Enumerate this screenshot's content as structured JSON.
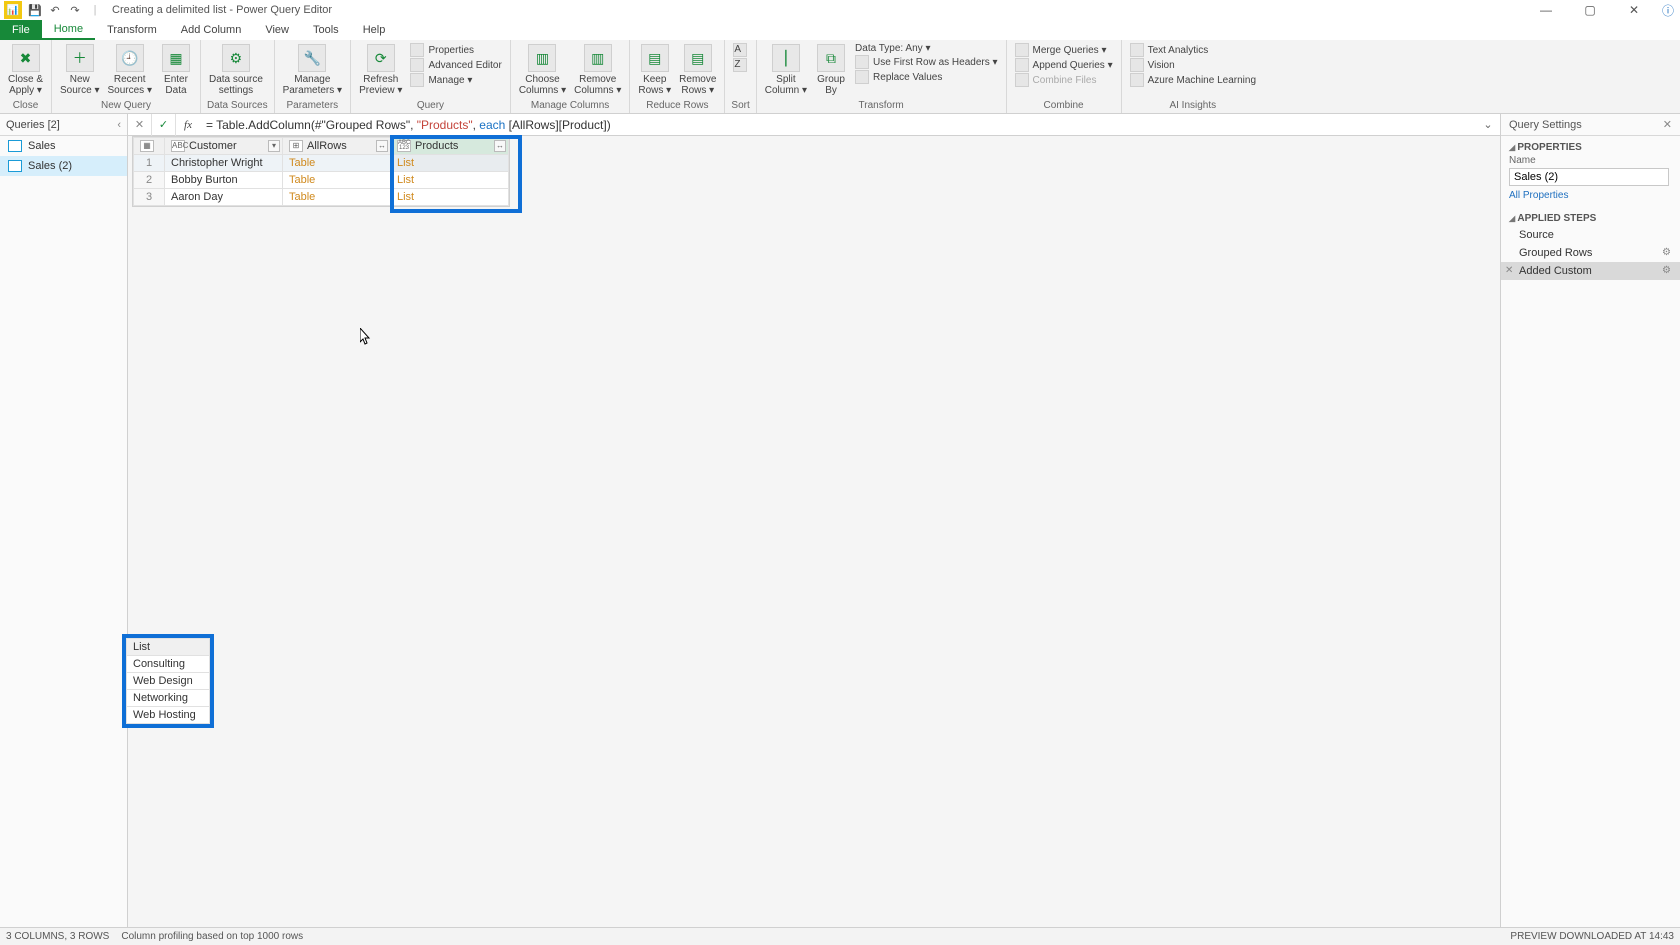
{
  "window": {
    "title": "Creating a delimited list - Power Query Editor"
  },
  "menu": {
    "file": "File",
    "home": "Home",
    "transform": "Transform",
    "addcolumn": "Add Column",
    "view": "View",
    "tools": "Tools",
    "help": "Help"
  },
  "ribbon": {
    "close_apply": "Close &\nApply ▾",
    "new_source": "New\nSource ▾",
    "recent_sources": "Recent\nSources ▾",
    "enter_data": "Enter\nData",
    "data_source_settings": "Data source\nsettings",
    "manage_parameters": "Manage\nParameters ▾",
    "refresh_preview": "Refresh\nPreview ▾",
    "properties": "Properties",
    "advanced_editor": "Advanced Editor",
    "manage": "Manage ▾",
    "choose_columns": "Choose\nColumns ▾",
    "remove_columns": "Remove\nColumns ▾",
    "keep_rows": "Keep\nRows ▾",
    "remove_rows": "Remove\nRows ▾",
    "sort": "",
    "split_column": "Split\nColumn ▾",
    "group_by": "Group\nBy",
    "data_type": "Data Type: Any ▾",
    "first_row_headers": "Use First Row as Headers ▾",
    "replace_values": "Replace Values",
    "merge_queries": "Merge Queries ▾",
    "append_queries": "Append Queries ▾",
    "combine_files": "Combine Files",
    "text_analytics": "Text Analytics",
    "vision": "Vision",
    "azure_ml": "Azure Machine Learning",
    "groups": {
      "close": "Close",
      "new_query": "New Query",
      "data_sources": "Data Sources",
      "parameters": "Parameters",
      "query": "Query",
      "manage_columns": "Manage Columns",
      "reduce_rows": "Reduce Rows",
      "sort": "Sort",
      "transform": "Transform",
      "combine": "Combine",
      "ai_insights": "AI Insights"
    }
  },
  "queries": {
    "header": "Queries [2]",
    "items": [
      "Sales",
      "Sales (2)"
    ]
  },
  "formula": {
    "prefix": "= Table.AddColumn(#\"Grouped Rows\", ",
    "str": "\"Products\"",
    "mid": ", ",
    "kw": "each",
    "suffix": " [AllRows][Product])"
  },
  "grid": {
    "columns": [
      "",
      "Customer",
      "AllRows",
      "Products"
    ],
    "type_icons": [
      "",
      "ABC",
      "⊞",
      "ABC\n123"
    ],
    "rows": [
      {
        "n": "1",
        "customer": "Christopher Wright",
        "allrows": "Table",
        "products": "List"
      },
      {
        "n": "2",
        "customer": "Bobby Burton",
        "allrows": "Table",
        "products": "List"
      },
      {
        "n": "3",
        "customer": "Aaron Day",
        "allrows": "Table",
        "products": "List"
      }
    ]
  },
  "preview": {
    "header": "List",
    "rows": [
      "Consulting",
      "Web Design",
      "Networking",
      "Web Hosting"
    ]
  },
  "settings": {
    "header": "Query Settings",
    "properties_title": "PROPERTIES",
    "name_label": "Name",
    "name_value": "Sales (2)",
    "all_properties": "All Properties",
    "applied_steps_title": "APPLIED STEPS",
    "steps": [
      "Source",
      "Grouped Rows",
      "Added Custom"
    ]
  },
  "status": {
    "left1": "3 COLUMNS, 3 ROWS",
    "left2": "Column profiling based on top 1000 rows",
    "right": "PREVIEW DOWNLOADED AT 14:43"
  }
}
